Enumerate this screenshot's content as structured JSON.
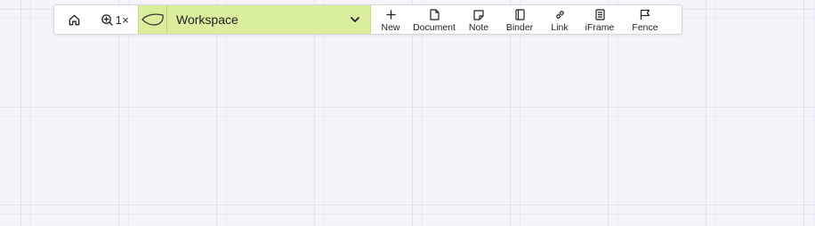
{
  "toolbar": {
    "home_icon": "home-icon",
    "zoom": {
      "icon": "zoom-in-icon",
      "value": "1×"
    },
    "workspace": {
      "label": "Workspace",
      "logo_icon": "leaf-icon",
      "chevron_icon": "chevron-down-icon",
      "accent": "#d8ee9c"
    },
    "actions": [
      {
        "label": "New",
        "icon": "plus-icon"
      },
      {
        "label": "Document",
        "icon": "document-icon"
      },
      {
        "label": "Note",
        "icon": "note-icon"
      },
      {
        "label": "Binder",
        "icon": "binder-icon"
      },
      {
        "label": "Link",
        "icon": "link-icon"
      },
      {
        "label": "iFrame",
        "icon": "iframe-icon"
      },
      {
        "label": "Fence",
        "icon": "flag-icon"
      }
    ]
  }
}
